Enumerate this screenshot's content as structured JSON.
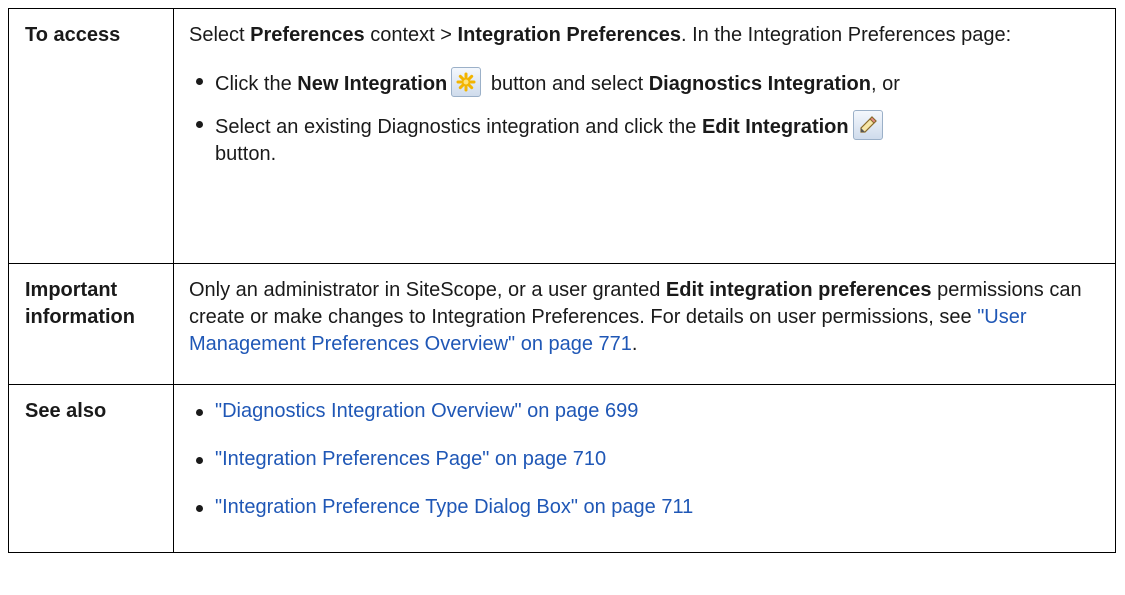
{
  "rows": {
    "access": {
      "heading": "To access",
      "intro": [
        {
          "text": "Select ",
          "bold": false
        },
        {
          "text": "Preferences",
          "bold": true
        },
        {
          "text": " context > ",
          "bold": false
        },
        {
          "text": "Integration Preferences",
          "bold": true
        },
        {
          "text": ". In the Integration Preferences page:",
          "bold": false
        }
      ],
      "bullet1": {
        "pre": "Click the ",
        "button": "New Integration",
        "mid": " button and select ",
        "option": "Diagnostics Integration",
        "post": ", or",
        "icon": "new-integration-icon"
      },
      "bullet2": {
        "pre": "Select an existing Diagnostics integration and click the ",
        "button": "Edit Integration",
        "post": "button.",
        "icon": "edit-integration-icon"
      }
    },
    "info": {
      "heading": "Important information",
      "pre": "Only an administrator in SiteScope, or a user granted ",
      "bold": "Edit integration preferences",
      "mid": " permissions can create or make changes to Integration Preferences. For details on user permissions, see ",
      "link": "\"User Management Preferences Overview\" on page 771",
      "post": "."
    },
    "see_also": {
      "heading": "See also",
      "links": [
        "\"Diagnostics Integration Overview\" on page 699",
        "\"Integration Preferences Page\" on page 710",
        "\"Integration Preference Type Dialog Box\" on page 711"
      ]
    }
  },
  "colors": {
    "link": "#1f57b6",
    "border": "#000000"
  }
}
